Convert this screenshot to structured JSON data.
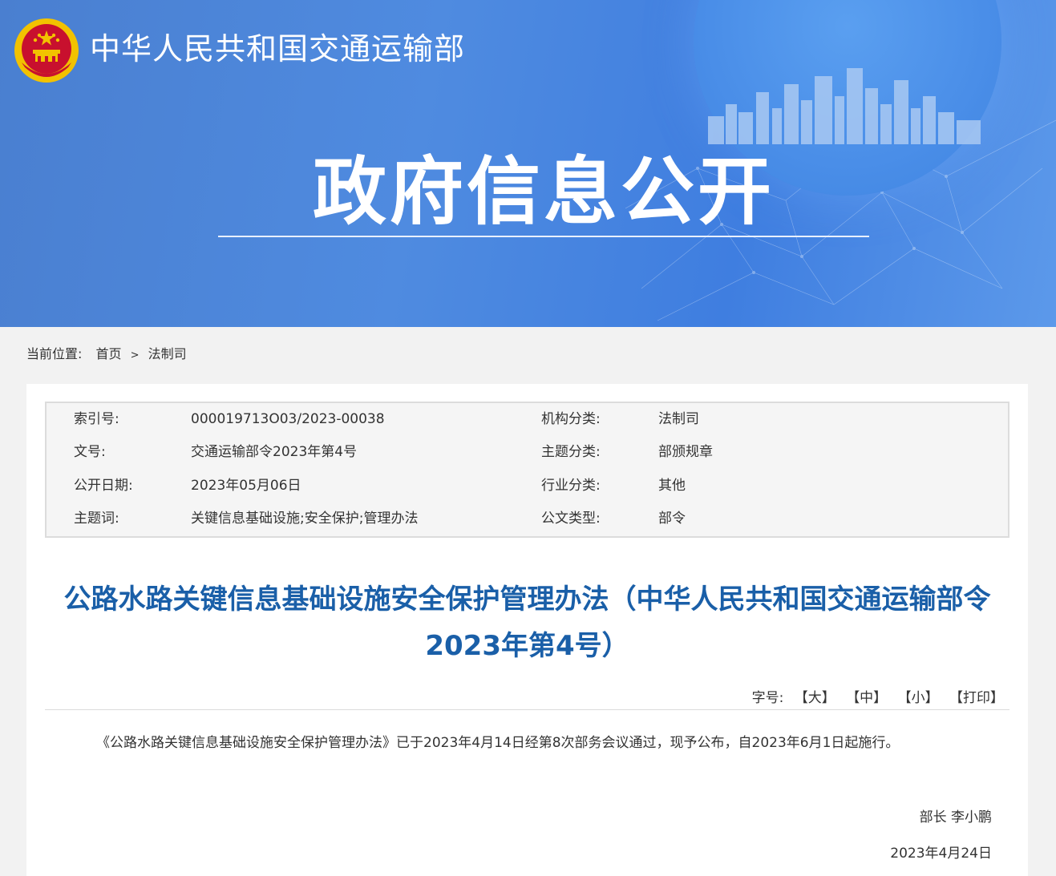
{
  "header": {
    "ministry_name": "中华人民共和国交通运输部",
    "banner_title": "政府信息公开"
  },
  "breadcrumb": {
    "label": "当前位置:",
    "home": "首页",
    "separator": ">",
    "current": "法制司"
  },
  "meta": {
    "rows": [
      {
        "label_left": "索引号:",
        "value_left": "000019713O03/2023-00038",
        "label_right": "机构分类:",
        "value_right": "法制司"
      },
      {
        "label_left": "文号:",
        "value_left": "交通运输部令2023年第4号",
        "label_right": "主题分类:",
        "value_right": "部颁规章"
      },
      {
        "label_left": "公开日期:",
        "value_left": "2023年05月06日",
        "label_right": "行业分类:",
        "value_right": "其他"
      },
      {
        "label_left": "主题词:",
        "value_left": "关键信息基础设施;安全保护;管理办法",
        "label_right": "公文类型:",
        "value_right": "部令"
      }
    ]
  },
  "document": {
    "title": "公路水路关键信息基础设施安全保护管理办法（中华人民共和国交通运输部令2023年第4号）",
    "font_label": "字号:",
    "font_large": "【大】",
    "font_medium": "【中】",
    "font_small": "【小】",
    "print": "【打印】",
    "body": "《公路水路关键信息基础设施安全保护管理办法》已于2023年4月14日经第8次部务会议通过，现予公布，自2023年6月1日起施行。",
    "signer": "部长 李小鹏",
    "date": "2023年4月24日"
  },
  "colors": {
    "banner_blue": "#4a86dc",
    "title_blue": "#1a5fa8",
    "emblem_red": "#c8102e",
    "emblem_gold": "#f2c200"
  }
}
